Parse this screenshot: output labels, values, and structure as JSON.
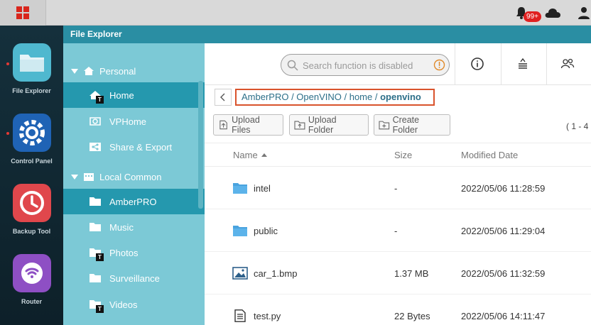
{
  "topbar": {
    "notification_badge": "99+"
  },
  "dock": {
    "items": [
      {
        "label": "File Explorer"
      },
      {
        "label": "Control Panel"
      },
      {
        "label": "Backup Tool"
      },
      {
        "label": "Router"
      }
    ]
  },
  "window": {
    "title": "File Explorer"
  },
  "tree": {
    "personal": {
      "label": "Personal",
      "items": [
        {
          "label": "Home"
        },
        {
          "label": "VPHome"
        },
        {
          "label": "Share & Export"
        }
      ]
    },
    "local_common": {
      "label": "Local Common",
      "items": [
        {
          "label": "AmberPRO"
        },
        {
          "label": "Music"
        },
        {
          "label": "Photos"
        },
        {
          "label": "Surveillance"
        },
        {
          "label": "Videos"
        }
      ]
    },
    "badge_letter": "T"
  },
  "search": {
    "placeholder": "Search function is disabled"
  },
  "breadcrumb": {
    "path_prefix": "AmberPRO / OpenVINO / home / ",
    "current": "openvino"
  },
  "actions": {
    "upload_files": "Upload Files",
    "upload_folder": "Upload Folder",
    "create_folder": "Create Folder"
  },
  "pagination": {
    "count": "( 1 - 4"
  },
  "table": {
    "headers": {
      "name": "Name",
      "size": "Size",
      "modified": "Modified Date"
    },
    "rows": [
      {
        "name": "intel",
        "size": "-",
        "modified": "2022/05/06 11:28:59",
        "icon": "folder-icon"
      },
      {
        "name": "public",
        "size": "-",
        "modified": "2022/05/06 11:29:04",
        "icon": "folder-icon"
      },
      {
        "name": "car_1.bmp",
        "size": "1.37 MB",
        "modified": "2022/05/06 11:32:59",
        "icon": "image-file-icon"
      },
      {
        "name": "test.py",
        "size": "22 Bytes",
        "modified": "2022/05/06 14:11:47",
        "icon": "text-file-icon"
      }
    ]
  },
  "colors": {
    "header_teal": "#2a8ea3",
    "tree_bg": "#7cc9d6",
    "tree_selected": "#2598ae",
    "accent_red": "#d9261c",
    "breadcrumb_border": "#d9532c"
  }
}
